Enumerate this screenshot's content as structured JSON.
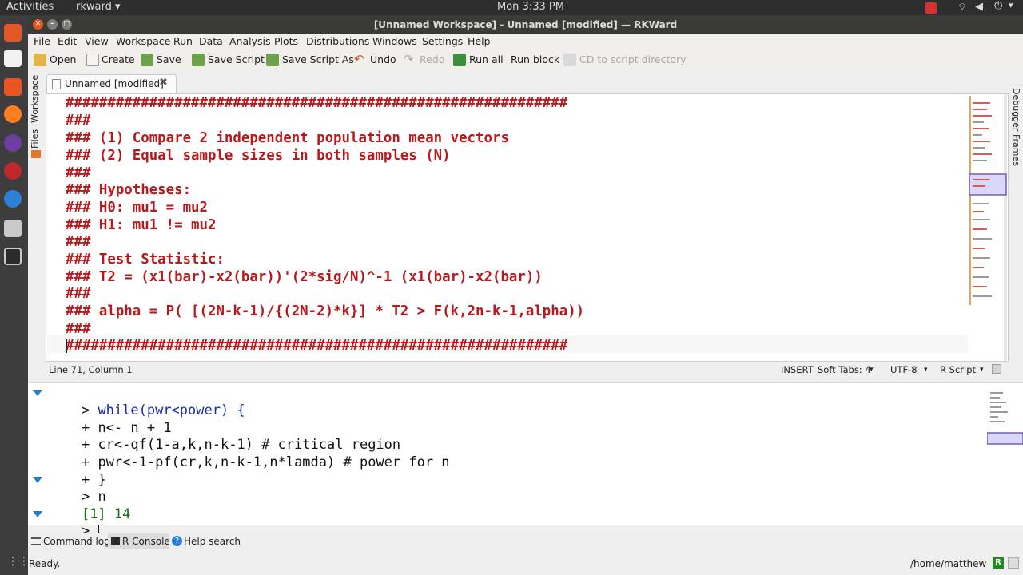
{
  "topbar": {
    "activities": "Activities",
    "app_menu": "rkward ▾",
    "clock": "Mon  3:33 PM"
  },
  "window": {
    "title": "[Unnamed Workspace] - Unnamed [modified] — RKWard"
  },
  "menu": [
    "File",
    "Edit",
    "View",
    "Workspace",
    "Run",
    "Data",
    "Analysis",
    "Plots",
    "Distributions",
    "Windows",
    "Settings",
    "Help"
  ],
  "toolbar": {
    "open": "Open",
    "create": "Create",
    "save": "Save",
    "save_script": "Save Script",
    "save_script_as": "Save Script As",
    "undo": "Undo",
    "redo": "Redo",
    "run_all": "Run all",
    "run_block": "Run block",
    "cd_script": "CD to script directory"
  },
  "side_tabs": {
    "workspace": "Workspace",
    "files": "Files",
    "debugger": "Debugger Frames"
  },
  "doc_tab": {
    "label": "Unnamed [modified]"
  },
  "script_lines": [
    "############################################################",
    "###",
    "### (1) Compare 2 independent population mean vectors",
    "### (2) Equal sample sizes in both samples (N)",
    "###",
    "### Hypotheses:",
    "### H0: mu1 = mu2",
    "### H1: mu1 != mu2",
    "###",
    "### Test Statistic:",
    "### T2 = (x1(bar)-x2(bar))'(2*sig/N)^-1 (x1(bar)-x2(bar))",
    "###",
    "### alpha = P( [(2N-k-1)/{(2N-2)*k}] * T2 > F(k,2n-k-1,alpha))",
    "###",
    "############################################################"
  ],
  "editor_status": {
    "position": "Line 71, Column 1",
    "mode": "INSERT",
    "tabs": "Soft Tabs: 4",
    "encoding": "UTF-8",
    "language": "R Script"
  },
  "console_lines": [
    {
      "prefix": "> ",
      "text": "while(pwr<power) {",
      "fold": true
    },
    {
      "prefix": "+ ",
      "text": "n<- n + 1",
      "fold": false
    },
    {
      "prefix": "+ ",
      "text": "cr<-qf(1-a,k,n-k-1) # critical region",
      "fold": false
    },
    {
      "prefix": "+ ",
      "text": "pwr<-1-pf(cr,k,n-k-1,n*lamda) # power for n",
      "fold": false
    },
    {
      "prefix": "+ ",
      "text": "}",
      "fold": false
    },
    {
      "prefix": "> ",
      "text": "n",
      "fold": true
    },
    {
      "prefix": "",
      "text": "[1] 14",
      "fold": false
    },
    {
      "prefix": "> ",
      "text": "",
      "fold": true
    }
  ],
  "bottom_tabs": {
    "command_log": "Command log",
    "r_console": "R Console",
    "help_search": "Help search"
  },
  "statusbar": {
    "status": "Ready.",
    "cwd": "/home/matthew",
    "r_badge": "R"
  }
}
